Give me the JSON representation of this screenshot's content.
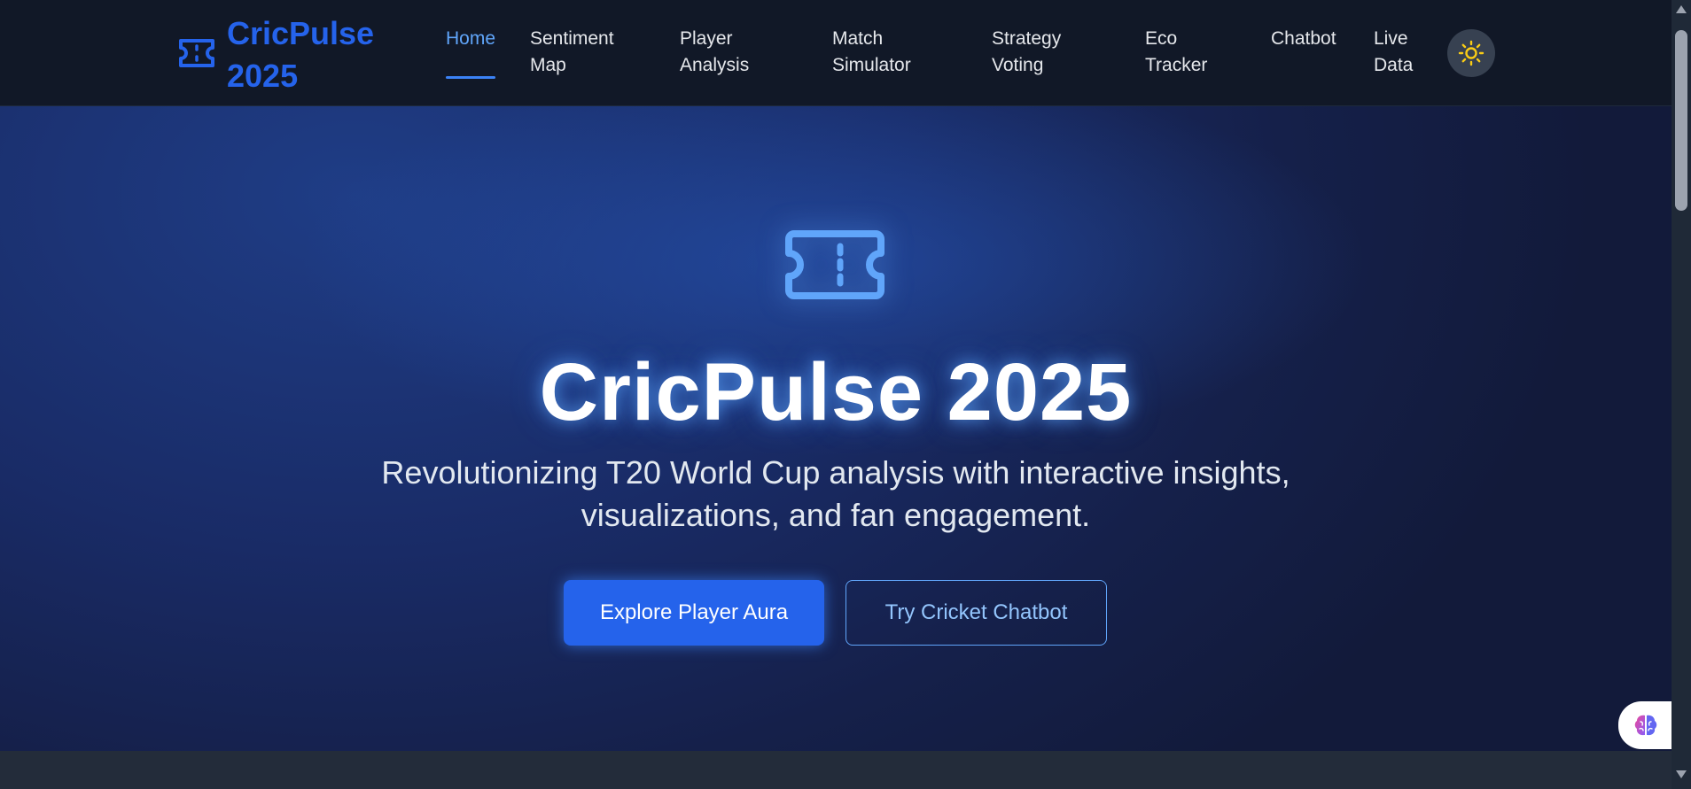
{
  "app": {
    "brand": "CricPulse 2025",
    "brand_icon": "ticket-icon"
  },
  "nav": {
    "items": [
      {
        "label": "Home",
        "active": true
      },
      {
        "label": "Sentiment Map"
      },
      {
        "label": "Player Analysis"
      },
      {
        "label": "Match Simulator"
      },
      {
        "label": "Strategy Voting"
      },
      {
        "label": "Eco Tracker"
      },
      {
        "label": "Chatbot"
      },
      {
        "label": "Live Data"
      }
    ],
    "theme_toggle_icon": "sun-icon"
  },
  "hero": {
    "icon": "ticket-icon",
    "title": "CricPulse 2025",
    "subtitle": "Revolutionizing T20 World Cup analysis with interactive insights, visualizations, and fan engagement.",
    "primary_button": "Explore Player Aura",
    "secondary_button": "Try Cricket Chatbot"
  },
  "floating": {
    "icon": "brain-icon"
  },
  "colors": {
    "accent": "#2563eb",
    "nav_bg": "#111827",
    "hero_bg": "#1e3a8a",
    "active_nav": "#60a5fa",
    "sun": "#facc15"
  }
}
